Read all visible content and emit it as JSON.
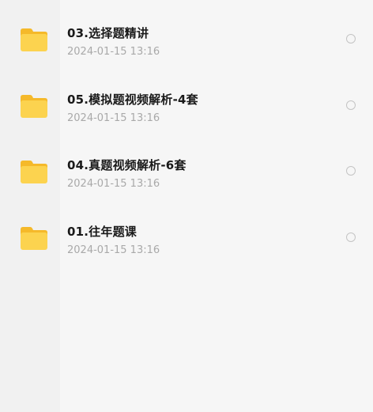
{
  "files": [
    {
      "name": "03.选择题精讲",
      "date": "2024-01-15 13:16",
      "icon": "folder-icon"
    },
    {
      "name": "05.模拟题视频解析-4套",
      "date": "2024-01-15 13:16",
      "icon": "folder-icon"
    },
    {
      "name": "04.真题视频解析-6套",
      "date": "2024-01-15 13:16",
      "icon": "folder-icon"
    },
    {
      "name": "01.往年题课",
      "date": "2024-01-15 13:16",
      "icon": "folder-icon"
    }
  ],
  "colors": {
    "folder_front": "#fcd34f",
    "folder_back": "#f5b92a"
  }
}
